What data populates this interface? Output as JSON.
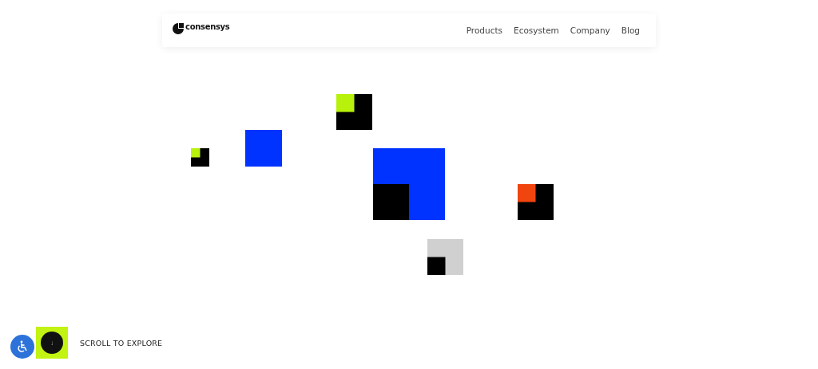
{
  "header": {
    "logo_text": "consensys",
    "nav": [
      {
        "label": "Products"
      },
      {
        "label": "Ecosystem"
      },
      {
        "label": "Company"
      },
      {
        "label": "Blog"
      }
    ]
  },
  "scroll_prompt": {
    "arrow": "↓",
    "label": "SCROLL TO EXPLORE"
  }
}
